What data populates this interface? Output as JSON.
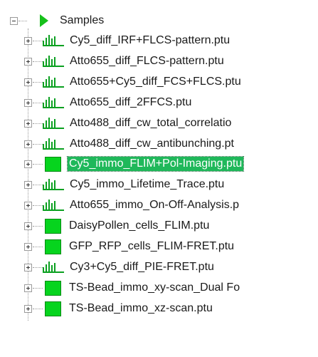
{
  "tree": {
    "root": {
      "label": "Samples",
      "icon": "green-triangle-icon",
      "expanded": true
    },
    "items": [
      {
        "label": "Cy5_diff_IRF+FLCS-pattern.ptu",
        "icon": "histogram-icon",
        "selected": false
      },
      {
        "label": "Atto655_diff_FLCS-pattern.ptu",
        "icon": "histogram-icon",
        "selected": false
      },
      {
        "label": "Atto655+Cy5_diff_FCS+FLCS.ptu",
        "icon": "histogram-icon",
        "selected": false
      },
      {
        "label": "Atto655_diff_2FFCS.ptu",
        "icon": "histogram-icon",
        "selected": false
      },
      {
        "label": "Atto488_diff_cw_total_correlatio",
        "icon": "histogram-icon",
        "selected": false
      },
      {
        "label": "Atto488_diff_cw_antibunching.pt",
        "icon": "histogram-icon",
        "selected": false
      },
      {
        "label": "Cy5_immo_FLIM+Pol-Imaging.ptu",
        "icon": "green-square-icon",
        "selected": true
      },
      {
        "label": "Cy5_immo_Lifetime_Trace.ptu",
        "icon": "histogram-icon",
        "selected": false
      },
      {
        "label": "Atto655_immo_On-Off-Analysis.p",
        "icon": "histogram-icon",
        "selected": false
      },
      {
        "label": "DaisyPollen_cells_FLIM.ptu",
        "icon": "green-square-icon",
        "selected": false
      },
      {
        "label": "GFP_RFP_cells_FLIM-FRET.ptu",
        "icon": "green-square-icon",
        "selected": false
      },
      {
        "label": "Cy3+Cy5_diff_PIE-FRET.ptu",
        "icon": "histogram-icon",
        "selected": false
      },
      {
        "label": "TS-Bead_immo_xy-scan_Dual Fo",
        "icon": "green-square-icon",
        "selected": false
      },
      {
        "label": "TS-Bead_immo_xz-scan.ptu",
        "icon": "green-square-icon",
        "selected": false
      }
    ]
  },
  "colors": {
    "selection_bg": "#1fb85a",
    "icon_green": "#06d41e",
    "histogram_green": "#0aa020"
  }
}
